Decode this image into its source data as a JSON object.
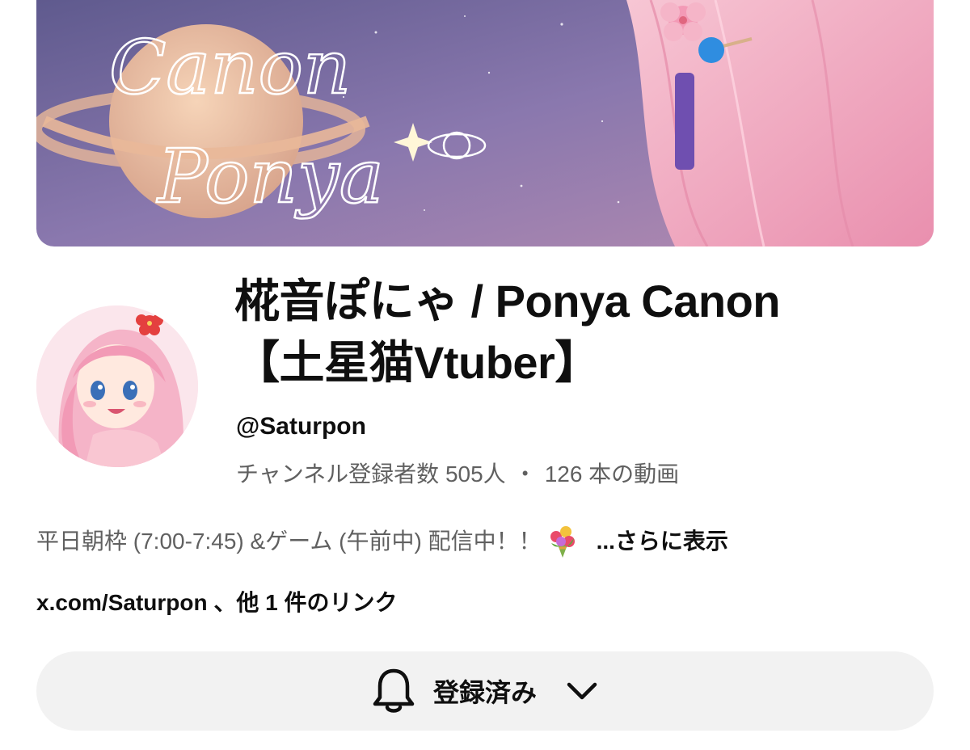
{
  "banner": {
    "script_line1": "Canon",
    "script_line2": "Ponya"
  },
  "channel": {
    "title_line1": "椛音ぽにゃ / Ponya Canon",
    "title_line2": "【土星猫Vtuber】",
    "handle": "@Saturpon",
    "subscribers": "チャンネル登録者数 505人",
    "separator": "・",
    "videos": "126 本の動画"
  },
  "description": {
    "text": "平日朝枠 (7:00-7:45) &ゲーム (午前中) 配信中！！",
    "emoji": "bouquet-icon",
    "more": "...さらに表示"
  },
  "links": {
    "text": "x.com/Saturpon 、他 1 件のリンク"
  },
  "subscribe_button": {
    "label": "登録済み",
    "icon": "bell-icon"
  },
  "colors": {
    "text_primary": "#0f0f0f",
    "text_secondary": "#606060",
    "button_bg": "#f2f2f2",
    "banner_sky": "#7a6aa0",
    "hair_pink": "#f2a8c0"
  }
}
